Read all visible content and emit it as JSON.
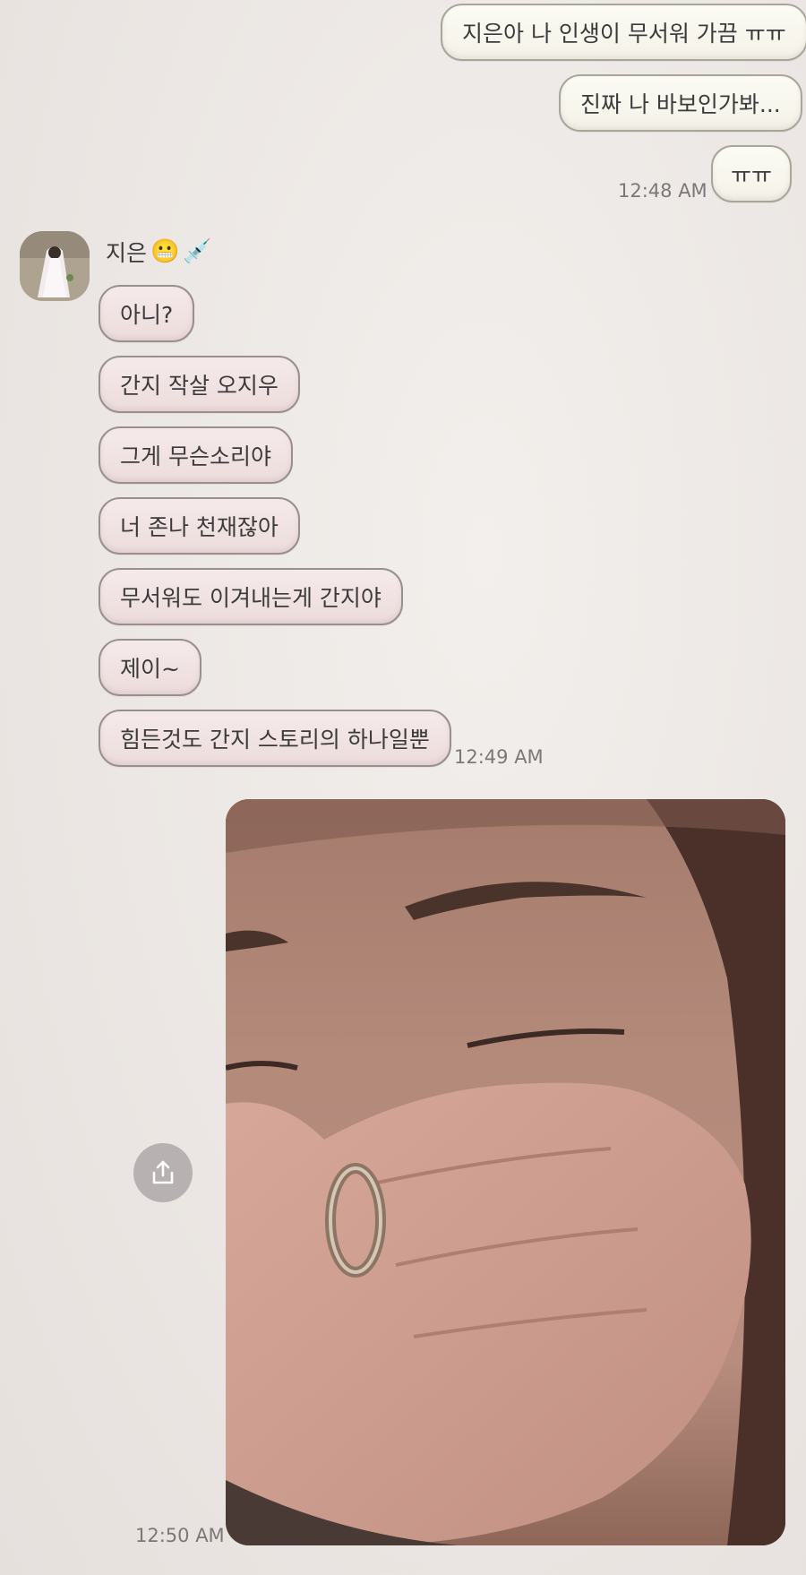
{
  "messages_out_1": [
    {
      "text": "지은아 나 인생이 무서워 가끔 ㅠㅠ"
    },
    {
      "text": "진짜 나 바보인가봐..."
    },
    {
      "text": "ㅠㅠ"
    }
  ],
  "time_out_1": "12:48 AM",
  "contact": {
    "name": "지은",
    "emoji_1": "😬",
    "emoji_2": "💉"
  },
  "messages_in": [
    {
      "text": "아니?"
    },
    {
      "text": "간지 작살 오지우"
    },
    {
      "text": "그게 무슨소리야"
    },
    {
      "text": "너 존나 천재잖아"
    },
    {
      "text": "무서워도 이겨내는게 간지야"
    },
    {
      "text": "제이~"
    },
    {
      "text": "힘든것도 간지 스토리의 하나일뿐"
    }
  ],
  "time_in": "12:49 AM",
  "time_out_2": "12:50 AM",
  "icons": {
    "share": "share-icon",
    "avatar": "avatar-photo",
    "photo": "face-photo"
  }
}
